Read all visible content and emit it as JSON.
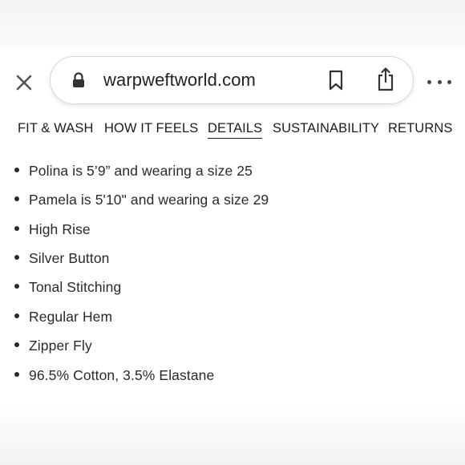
{
  "browser": {
    "url": "warpweftworld.com",
    "icons": [
      "close-icon",
      "lock-icon",
      "bookmark-icon",
      "share-icon",
      "more-icon"
    ]
  },
  "tabs": [
    {
      "label": "FIT & WASH",
      "active": false
    },
    {
      "label": "HOW IT FEELS",
      "active": false
    },
    {
      "label": "DETAILS",
      "active": true
    },
    {
      "label": "SUSTAINABILITY",
      "active": false
    },
    {
      "label": "RETURNS",
      "active": false
    }
  ],
  "details": [
    "Polina is 5’9” and wearing a size 25",
    "Pamela is 5'10\" and wearing a size 29",
    "High Rise",
    "Silver Button",
    "Tonal Stitching",
    "Regular Hem",
    "Zipper Fly",
    "96.5% Cotton, 3.5% Elastane"
  ]
}
